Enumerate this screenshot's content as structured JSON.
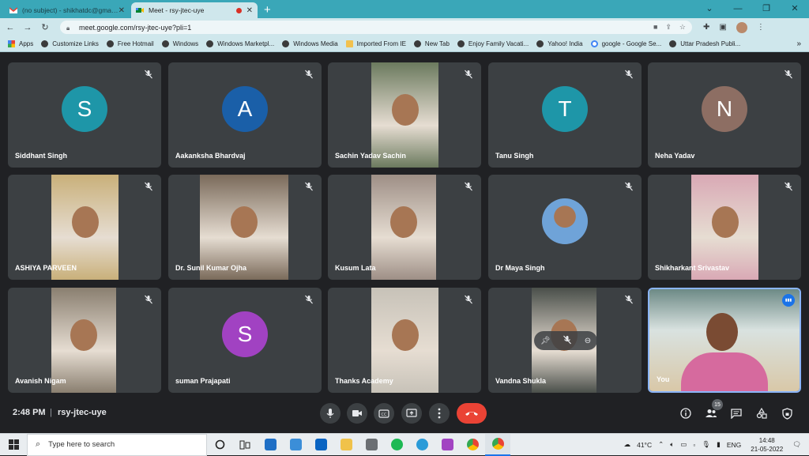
{
  "browser": {
    "tabs": [
      {
        "title": "(no subject) - shikhatdc@gmail.c",
        "active": false
      },
      {
        "title": "Meet - rsy-jtec-uye",
        "active": true
      }
    ],
    "new_tab": "+",
    "url": "meet.google.com/rsy-jtec-uye?pli=1",
    "bookmarks": [
      {
        "label": "Apps",
        "icon": "apps-icon"
      },
      {
        "label": "Customize Links",
        "icon": "globe-icon"
      },
      {
        "label": "Free Hotmail",
        "icon": "globe-icon"
      },
      {
        "label": "Windows",
        "icon": "globe-icon"
      },
      {
        "label": "Windows Marketpl...",
        "icon": "globe-icon"
      },
      {
        "label": "Windows Media",
        "icon": "globe-icon"
      },
      {
        "label": "Imported From IE",
        "icon": "folder-icon"
      },
      {
        "label": "New Tab",
        "icon": "globe-icon"
      },
      {
        "label": "Enjoy Family Vacati...",
        "icon": "globe-icon"
      },
      {
        "label": "Yahoo! India",
        "icon": "globe-icon"
      },
      {
        "label": "google - Google Se...",
        "icon": "google-icon"
      },
      {
        "label": "Uttar Pradesh Publi...",
        "icon": "globe-icon"
      }
    ]
  },
  "participants": [
    {
      "name": "Siddhant Singh",
      "initial": "S",
      "color": "#1e96a8",
      "type": "avatar"
    },
    {
      "name": "Aakanksha Bhardvaj",
      "initial": "A",
      "color": "#1a5fa8",
      "type": "avatar"
    },
    {
      "name": "Sachin Yadav Sachin",
      "initial": "",
      "color": "#6b7a5e",
      "type": "video"
    },
    {
      "name": "Tanu Singh",
      "initial": "T",
      "color": "#1e96a8",
      "type": "avatar"
    },
    {
      "name": "Neha Yadav",
      "initial": "N",
      "color": "#8d6e63",
      "type": "avatar"
    },
    {
      "name": "ASHIYA PARVEEN",
      "initial": "",
      "color": "#c9b07a",
      "type": "video"
    },
    {
      "name": "Dr. Sunil Kumar Ojha",
      "initial": "",
      "color": "#7a6a5a",
      "type": "video"
    },
    {
      "name": "Kusum Lata",
      "initial": "",
      "color": "#9e8f86",
      "type": "video"
    },
    {
      "name": "Dr Maya Singh",
      "initial": "",
      "color": "#6fa3d8",
      "type": "photo"
    },
    {
      "name": "Shikharkant Srivastav",
      "initial": "",
      "color": "#d9a9b5",
      "type": "video"
    },
    {
      "name": "Avanish Nigam",
      "initial": "",
      "color": "#8a7f70",
      "type": "video"
    },
    {
      "name": "suman Prajapati",
      "initial": "S",
      "color": "#a142c2",
      "type": "avatar"
    },
    {
      "name": "Thanks Academy",
      "initial": "",
      "color": "#c7c2b8",
      "type": "video"
    },
    {
      "name": "Vandna Shukla",
      "initial": "",
      "color": "#4a4f4a",
      "type": "video"
    },
    {
      "name": "You",
      "initial": "",
      "color": "#d9c8a8",
      "type": "self"
    }
  ],
  "meeting": {
    "time": "2:48 PM",
    "separator": "|",
    "code": "rsy-jtec-uye",
    "participant_count": "15"
  },
  "taskbar": {
    "search_placeholder": "Type here to search",
    "weather": "41°C",
    "language": "ENG",
    "time": "14:48",
    "date": "21-05-2022"
  },
  "colors": {
    "chrome_frame": "#3aa7b8",
    "toolbar": "#cfe7ec",
    "meet_bg": "#202124",
    "tile_bg": "#3c4043",
    "end_call": "#ea4335"
  }
}
